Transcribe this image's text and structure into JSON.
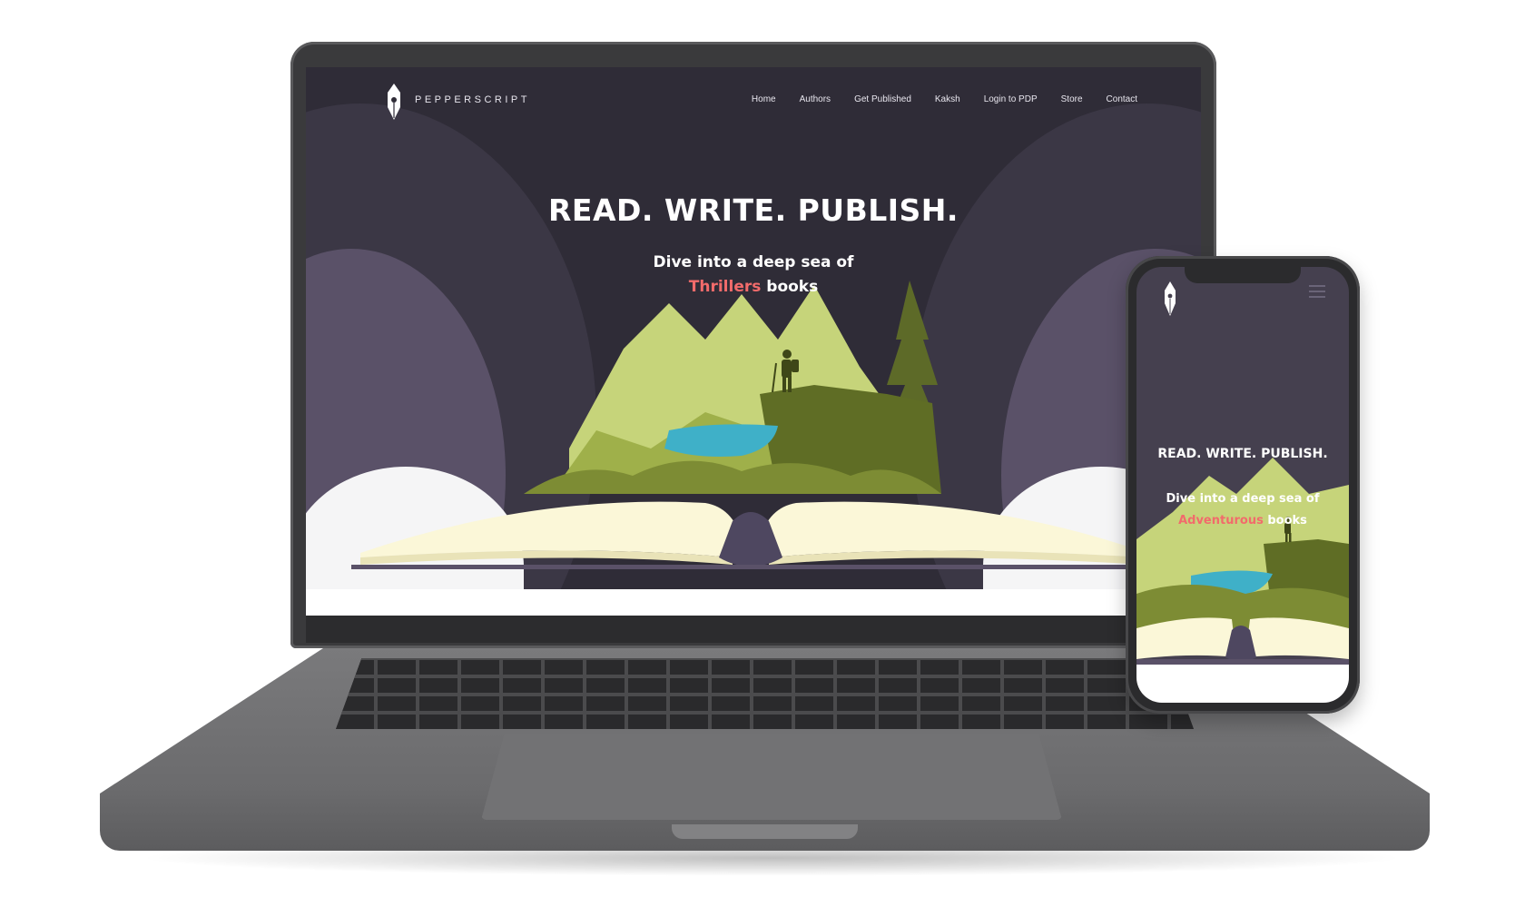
{
  "site": {
    "brand": "PEPPERSCRIPT",
    "nav": [
      "Home",
      "Authors",
      "Get Published",
      "Kaksh",
      "Login to PDP",
      "Store",
      "Contact"
    ]
  },
  "desktop_hero": {
    "title": "READ. WRITE. PUBLISH.",
    "subtitle_prefix": "Dive into a deep sea of",
    "genre": "Thrillers",
    "subtitle_suffix": "books"
  },
  "mobile_hero": {
    "title": "READ. WRITE. PUBLISH.",
    "subtitle_prefix": "Dive into a deep sea of",
    "genre": "Adventurous",
    "subtitle_suffix": "books"
  },
  "colors": {
    "background": "#2f2c37",
    "accent": "#f26b6b",
    "mountain_light": "#c6d47a",
    "mountain_dark": "#6b7a2c",
    "lake": "#3fb0c8",
    "page": "#fbf7d8"
  },
  "icons": {
    "logo": "pen-nib-icon",
    "menu": "hamburger-menu-icon"
  }
}
